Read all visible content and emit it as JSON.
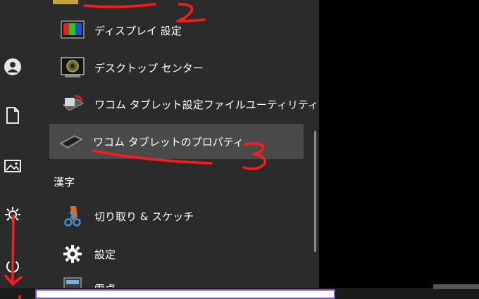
{
  "menu": {
    "items": [
      {
        "label": "ディスプレイ 設定",
        "icon": "display-settings-icon"
      },
      {
        "label": "デスクトップ センター",
        "icon": "desktop-center-icon"
      },
      {
        "label": "ワコム タブレット設定ファイルユーティリティ",
        "icon": "wacom-utility-icon"
      },
      {
        "label": "ワコム タブレットのプロパティ",
        "icon": "wacom-tablet-icon"
      },
      {
        "label": "切り取り & スケッチ",
        "icon": "snip-sketch-icon"
      },
      {
        "label": "設定",
        "icon": "gear-icon"
      },
      {
        "label": "電卓",
        "icon": "calculator-icon"
      }
    ],
    "section_header": "漢字"
  },
  "rail": {
    "icons": [
      "user-icon",
      "document-icon",
      "pictures-icon",
      "settings-gear-icon",
      "power-icon"
    ]
  },
  "annotations": {
    "color": "#ff1a1a",
    "number_2": "2",
    "number_3": "3"
  },
  "colors": {
    "panel": "#2b2b2b",
    "selected": "#4a4a4a",
    "search_border": "#7b47c9"
  }
}
